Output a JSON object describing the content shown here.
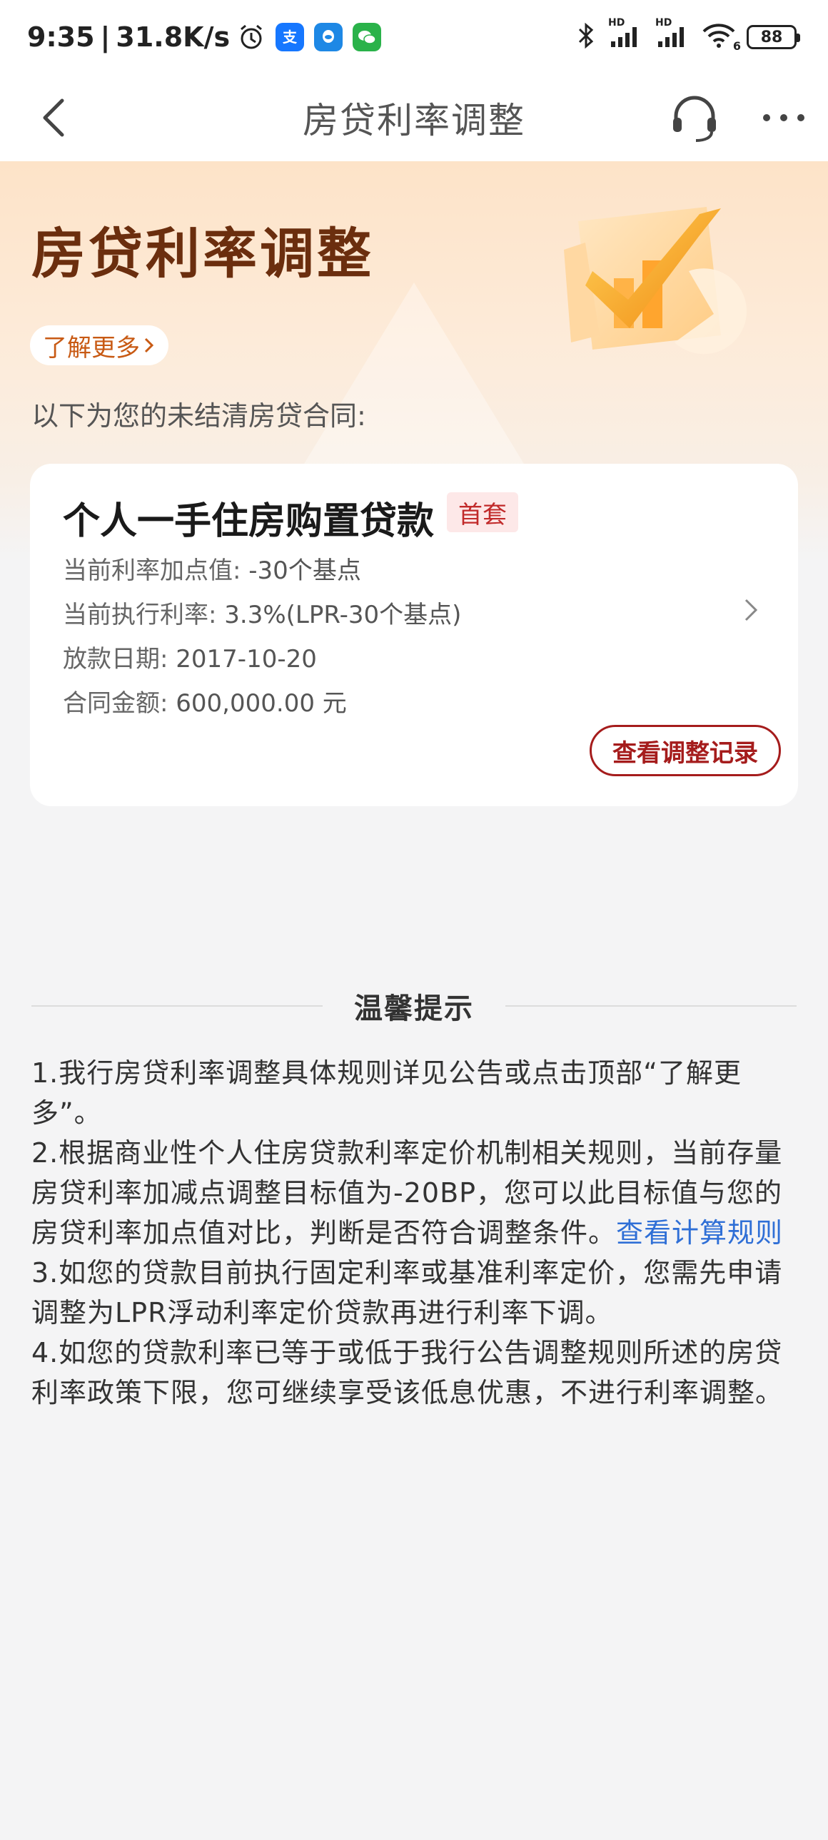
{
  "status_bar": {
    "time": "9:35",
    "separator": "|",
    "net_speed": "31.8K/s",
    "battery": "88",
    "signal_label_1": "HD",
    "signal_label_2": "HD",
    "wifi_label": "6"
  },
  "nav": {
    "title": "房贷利率调整"
  },
  "hero": {
    "title": "房贷利率调整",
    "learn_more": "了解更多",
    "subtitle": "以下为您的未结清房贷合同:"
  },
  "loan": {
    "name": "个人一手住房购置贷款",
    "tag": "首套",
    "rows": [
      {
        "label": "当前利率加点值:",
        "value": "-30个基点"
      },
      {
        "label": "当前执行利率:",
        "value": "3.3%(LPR-30个基点)"
      },
      {
        "label": "放款日期:",
        "value": "2017-10-20"
      },
      {
        "label": "合同金额:",
        "value": "600,000.00 元"
      }
    ],
    "record_button": "查看调整记录"
  },
  "tips": {
    "title": "温馨提示",
    "item1": "1.我行房贷利率调整具体规则详见公告或点击顶部“了解更多”。",
    "item2": "2.根据商业性个人住房贷款利率定价机制相关规则，当前存量房贷利率加减点调整目标值为-20BP，您可以此目标值与您的房贷利率加点值对比，判断是否符合调整条件。",
    "item2_link": "查看计算规则",
    "item3": "3.如您的贷款目前执行固定利率或基准利率定价，您需先申请调整为LPR浮动利率定价贷款再进行利率下调。",
    "item4": "4.如您的贷款利率已等于或低于我行公告调整规则所述的房贷利率政策下限，您可继续享受该低息优惠，不进行利率调整。"
  },
  "colors": {
    "brand_red": "#a51c1c",
    "title_brown": "#6b2e0e",
    "link_blue": "#2f6fd6",
    "hero_orange": "#f5a623"
  }
}
